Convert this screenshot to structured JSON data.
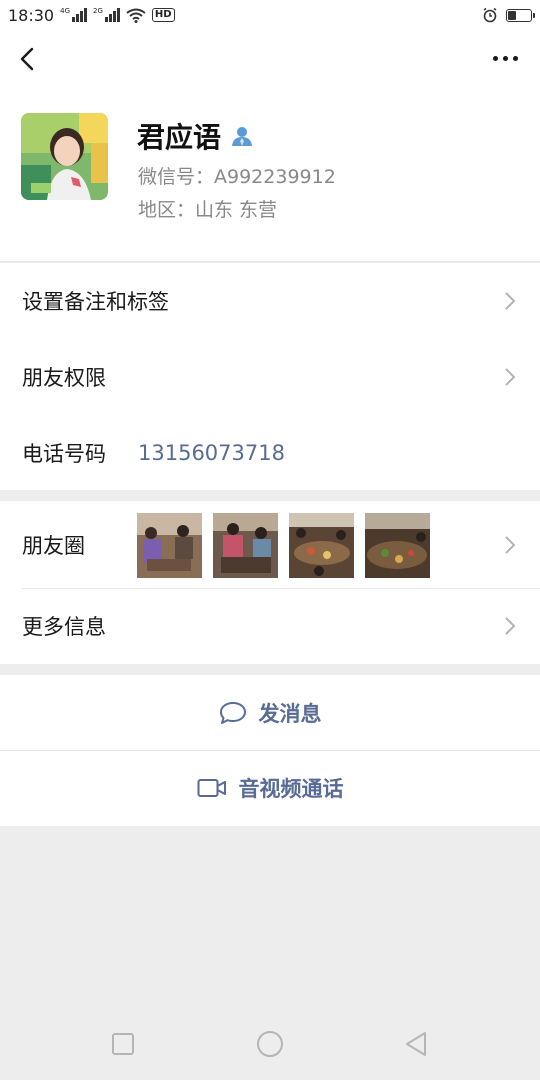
{
  "status_bar": {
    "time": "18:30",
    "network_1": "4G",
    "network_2": "2G",
    "hd_label": "HD",
    "icons": [
      "signal-icon",
      "wifi-icon",
      "alarm-icon",
      "battery-icon"
    ],
    "battery_level": 0.35
  },
  "nav": {
    "back_icon": "chevron-left-icon",
    "more_icon": "more-dots-icon"
  },
  "profile": {
    "name": "君应语",
    "wechat_id": "微信号：A992239912",
    "region": "地区：山东  东营"
  },
  "rows": {
    "remark_tags": "设置备注和标签",
    "friend_permissions": "朋友权限",
    "phone_label": "电话号码",
    "phone_value": "13156073718",
    "moments": "朋友圈",
    "more_info": "更多信息"
  },
  "actions": {
    "send_message": "发消息",
    "av_call": "音视频通话"
  },
  "colors": {
    "link": "#576b95",
    "background": "#ededed",
    "card": "#ffffff"
  }
}
